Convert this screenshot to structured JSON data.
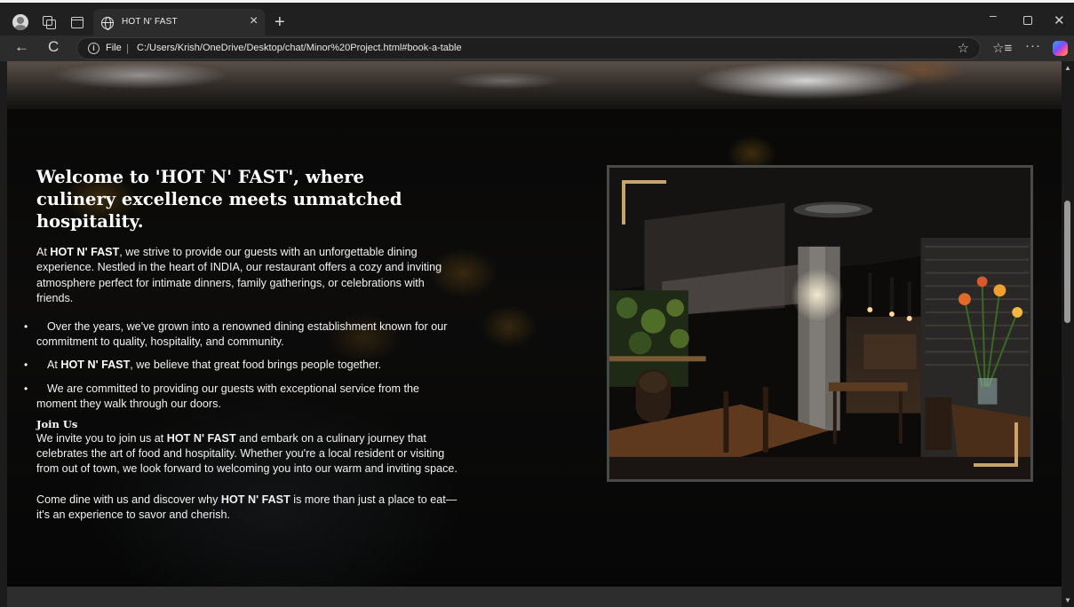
{
  "browser": {
    "tab_title": "HOT N' FAST",
    "tab_close": "×",
    "new_tab": "+",
    "file_label": "File",
    "separator": "|",
    "url": "C:/Users/Krish/OneDrive/Desktop/chat/Minor%20Project.html#book-a-table",
    "icons": [
      "profile-icon",
      "workspaces-icon",
      "tab-actions-icon",
      "globe-icon",
      "back-icon",
      "reload-icon",
      "info-icon",
      "favorite-star-icon",
      "favorites-icon",
      "more-icon",
      "copilot-icon",
      "minimize-icon",
      "maximize-icon",
      "close-icon"
    ],
    "glyphs": {
      "back": "←",
      "reload": "C",
      "info": "i",
      "star": "☆",
      "favs": "☆≡",
      "more": "···",
      "min": "–",
      "close": "✕",
      "scroll_up": "▲",
      "scroll_down": "▼"
    }
  },
  "about": {
    "heading": "Welcome to 'HOT N' FAST', where culinery excellence meets unmatched hospitality.",
    "intro": {
      "before": "At ",
      "brand": "HOT N' FAST",
      "after": ", we strive to provide our guests with an unforgettable dining experience. Nestled in the heart of INDIA, our restaurant offers a cozy and inviting atmosphere perfect for intimate dinners, family gatherings, or celebrations with friends."
    },
    "bullets": [
      {
        "before": " Over the years, we've grown into a renowned dining establishment known for our commitment to quality, hospitality, and community.",
        "brand": "",
        "after": ""
      },
      {
        "before": " At ",
        "brand": "HOT N' FAST",
        "after": ", we believe that great food brings people together."
      },
      {
        "before": " We are committed to providing our guests with exceptional service from the moment they walk through our doors.",
        "brand": "",
        "after": ""
      }
    ],
    "join_title": "Join Us",
    "join": {
      "before": "We invite you to join us at ",
      "brand": "HOT N' FAST",
      "after": " and embark on a culinary journey that celebrates the art of food and hospitality. Whether you're a local resident or visiting from out of town, we look forward to welcoming you into our warm and inviting space."
    },
    "closing": {
      "before": "Come dine with us and discover why ",
      "brand": "HOT N' FAST",
      "after": " is more than just a place to eat—it's an experience to savor and cherish."
    },
    "accent_color": "#c7a46b"
  }
}
